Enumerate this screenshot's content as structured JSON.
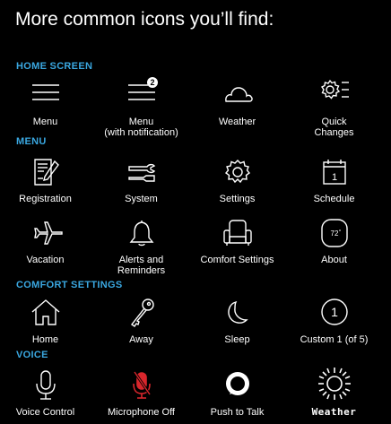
{
  "title": "More common icons you’ll find:",
  "sections": {
    "home": "HOME SCREEN",
    "menu": "MENU",
    "comfort": "COMFORT SETTINGS",
    "voice": "VOICE"
  },
  "home_items": [
    {
      "icon": "hamburger-menu-icon",
      "label1": "Menu",
      "label2": ""
    },
    {
      "icon": "menu-notification-icon",
      "label1": "Menu",
      "label2": "(with notification)",
      "badge": "2"
    },
    {
      "icon": "cloud-icon",
      "label1": "Weather",
      "label2": ""
    },
    {
      "icon": "quick-changes-icon",
      "label1": "Quick",
      "label2": "Changes"
    }
  ],
  "menu_items": [
    {
      "icon": "registration-icon",
      "label1": "Registration",
      "label2": ""
    },
    {
      "icon": "system-tools-icon",
      "label1": "System",
      "label2": ""
    },
    {
      "icon": "gear-icon",
      "label1": "Settings",
      "label2": ""
    },
    {
      "icon": "calendar-icon",
      "label1": "Schedule",
      "label2": "",
      "day": "1"
    },
    {
      "icon": "airplane-icon",
      "label1": "Vacation",
      "label2": ""
    },
    {
      "icon": "bell-icon",
      "label1": "Alerts and",
      "label2": "Reminders"
    },
    {
      "icon": "armchair-icon",
      "label1": "Comfort Settings",
      "label2": ""
    },
    {
      "icon": "thermostat-icon",
      "label1": "About",
      "label2": "",
      "temp": "72"
    }
  ],
  "comfort_items": [
    {
      "icon": "home-icon",
      "label1": "Home",
      "label2": ""
    },
    {
      "icon": "key-icon",
      "label1": "Away",
      "label2": ""
    },
    {
      "icon": "moon-icon",
      "label1": "Sleep",
      "label2": ""
    },
    {
      "icon": "custom-circle-icon",
      "label1": "Custom 1 (of 5)",
      "label2": "",
      "num": "1"
    }
  ],
  "voice_items": [
    {
      "icon": "microphone-icon",
      "label1": "Voice Control",
      "label2": ""
    },
    {
      "icon": "microphone-off-icon",
      "label1": "Microphone Off",
      "label2": ""
    },
    {
      "icon": "push-to-talk-ring-icon",
      "label1": "Push to Talk",
      "label2": ""
    },
    {
      "icon": "sun-weather-icon",
      "label1": "Weather",
      "label2": ""
    }
  ],
  "colors": {
    "accent": "#3aa7e0",
    "mic_off": "#d9262c",
    "background": "#000000",
    "text": "#ffffff"
  }
}
